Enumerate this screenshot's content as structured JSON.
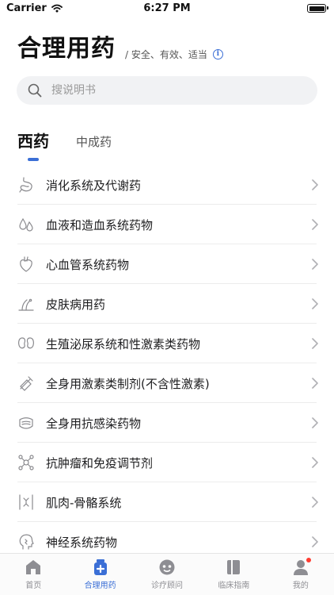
{
  "status_bar": {
    "carrier": "Carrier",
    "time": "6:27 PM"
  },
  "header": {
    "title": "合理用药",
    "subtitle": "/ 安全、有效、适当"
  },
  "search": {
    "placeholder": "搜说明书"
  },
  "tabs": [
    {
      "label": "西药",
      "active": true
    },
    {
      "label": "中成药",
      "active": false
    }
  ],
  "categories": [
    {
      "label": "消化系统及代谢药",
      "icon": "stomach-icon"
    },
    {
      "label": "血液和造血系统药物",
      "icon": "blood-drops-icon"
    },
    {
      "label": "心血管系统药物",
      "icon": "heart-icon"
    },
    {
      "label": "皮肤病用药",
      "icon": "skin-hair-icon"
    },
    {
      "label": "生殖泌尿系统和性激素类药物",
      "icon": "kidney-icon"
    },
    {
      "label": "全身用激素类制剂(不含性激素)",
      "icon": "syringe-icon"
    },
    {
      "label": "全身用抗感染药物",
      "icon": "mask-icon"
    },
    {
      "label": "抗肿瘤和免疫调节剂",
      "icon": "molecule-icon"
    },
    {
      "label": "肌肉-骨骼系统",
      "icon": "bone-icon"
    },
    {
      "label": "神经系统药物",
      "icon": "head-icon"
    }
  ],
  "tabbar": [
    {
      "label": "首页",
      "icon": "home-icon",
      "active": false
    },
    {
      "label": "合理用药",
      "icon": "medicine-kit-icon",
      "active": true
    },
    {
      "label": "诊疗顾问",
      "icon": "consult-icon",
      "active": false
    },
    {
      "label": "临床指南",
      "icon": "book-icon",
      "active": false
    },
    {
      "label": "我的",
      "icon": "profile-icon",
      "active": false,
      "badge": true
    }
  ],
  "colors": {
    "accent": "#3b6fd6",
    "badge": "#ff3b30",
    "icon_gray": "#8a8a8e"
  }
}
